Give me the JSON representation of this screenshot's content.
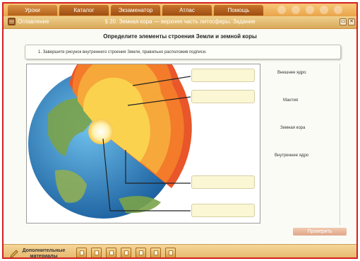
{
  "nav": {
    "tabs": [
      {
        "label": "Уроки",
        "active": true
      },
      {
        "label": "Каталог",
        "active": false
      },
      {
        "label": "Экзаменатор",
        "active": false
      },
      {
        "label": "Атлас",
        "active": false
      },
      {
        "label": "Помощь",
        "active": false
      }
    ]
  },
  "titlebar": {
    "toc_label": "Оглавление",
    "lesson_title": "§ 20. Земная кора — верхняя часть литосферы. Задание",
    "minimize_icon": "window-minimize-icon",
    "close_icon": "close-icon"
  },
  "main": {
    "heading": "Определите элементы строения Земли и  земной коры",
    "task_text": "1. Завершите рисунок внутреннего строения Земли, правильно расположив подписи.",
    "options": [
      "Внешнее ядро",
      "Мантия",
      "Земная кора",
      "Внутреннее ядро"
    ],
    "answer_slots": [
      "",
      "",
      "",
      ""
    ],
    "check_label": "Проверить"
  },
  "bottombar": {
    "extra_materials": "Дополнительные материалы",
    "tool_icons": [
      "document-icon",
      "document-icon",
      "document-icon",
      "checklist-icon",
      "document-icon",
      "document-icon",
      "pencil-icon"
    ]
  },
  "colors": {
    "frame_border": "#d42020",
    "crust": "#e8562a",
    "mantle": "#f39a2a",
    "outer_core": "#fbd24e",
    "inner_core": "#fff6d0",
    "ocean": "#2c86c8"
  }
}
